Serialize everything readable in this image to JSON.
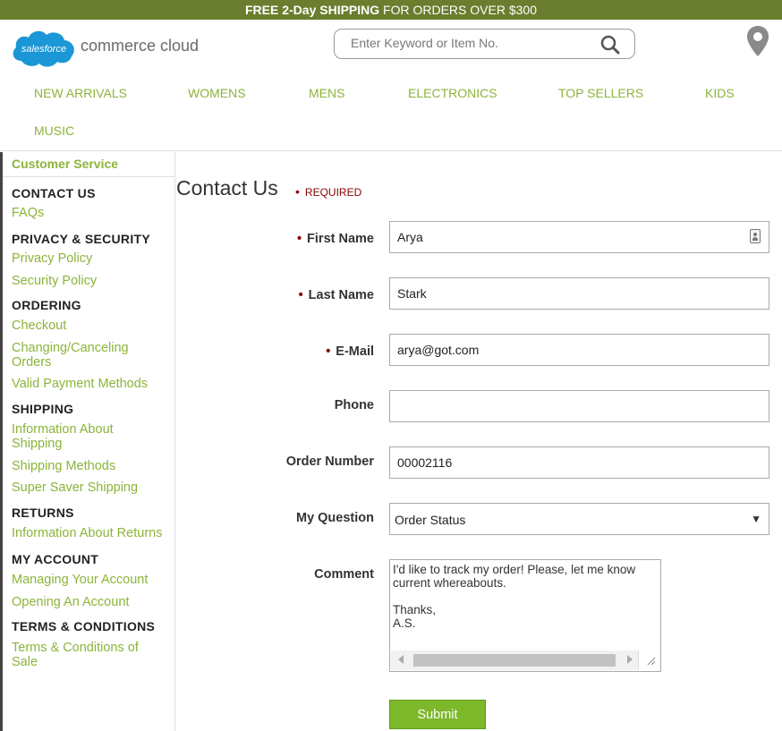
{
  "promo": {
    "bold": "FREE 2-Day SHIPPING",
    "rest": " FOR ORDERS OVER $300"
  },
  "logo": {
    "brand": "salesforce",
    "product": "commerce cloud"
  },
  "search": {
    "placeholder": "Enter Keyword or Item No.",
    "icon": "search-icon"
  },
  "store_locator": {
    "icon": "map-pin-icon"
  },
  "nav": [
    "NEW ARRIVALS",
    "WOMENS",
    "MENS",
    "ELECTRONICS",
    "TOP SELLERS",
    "KIDS",
    "MUSIC"
  ],
  "sidebar": {
    "title": "Customer Service",
    "sections": [
      {
        "heading": "CONTACT US",
        "links": [
          "FAQs"
        ]
      },
      {
        "heading": "PRIVACY & SECURITY",
        "links": [
          "Privacy Policy",
          "Security Policy"
        ]
      },
      {
        "heading": "ORDERING",
        "links": [
          "Checkout",
          "Changing/Canceling Orders",
          "Valid Payment Methods"
        ]
      },
      {
        "heading": "SHIPPING",
        "links": [
          "Information About Shipping",
          "Shipping Methods",
          "Super Saver Shipping"
        ]
      },
      {
        "heading": "RETURNS",
        "links": [
          "Information About Returns"
        ]
      },
      {
        "heading": "MY ACCOUNT",
        "links": [
          "Managing Your Account",
          "Opening An Account"
        ]
      },
      {
        "heading": "TERMS & CONDITIONS",
        "links": [
          "Terms & Conditions of Sale"
        ]
      }
    ]
  },
  "form": {
    "title": "Contact Us",
    "required_note": "REQUIRED",
    "first_name": {
      "label": "First Name",
      "value": "Arya"
    },
    "last_name": {
      "label": "Last Name",
      "value": "Stark"
    },
    "email": {
      "label": "E-Mail",
      "value": "arya@got.com"
    },
    "phone": {
      "label": "Phone",
      "value": ""
    },
    "order_number": {
      "label": "Order Number",
      "value": "00002116"
    },
    "question": {
      "label": "My Question",
      "value": "Order Status"
    },
    "comment": {
      "label": "Comment",
      "value": "I'd like to track my order! Please, let me know current whereabouts.\n\nThanks,\nA.S."
    },
    "submit_label": "Submit"
  },
  "colors": {
    "promo_bar": "#6b7d2e",
    "accent_green": "#8cb43a",
    "required_red": "#8b0000",
    "button_green": "#7cb82a"
  }
}
